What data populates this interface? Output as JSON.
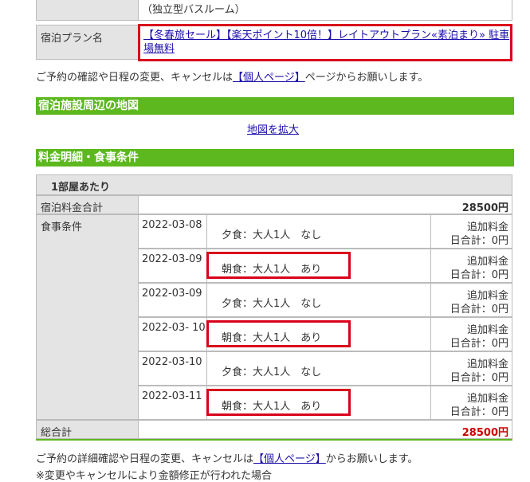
{
  "room": {
    "bath_note": "（独立型バスルーム）"
  },
  "plan": {
    "label": "宿泊プラン名",
    "name": "【冬春旅セール】【楽天ポイント10倍！】レイトアウトプラン«素泊まり» 駐車場無料"
  },
  "notice1": {
    "before": "ご予約の確認や日程の変更、キャンセルは",
    "link": "【個人ページ】",
    "after": "ページからお願いします。"
  },
  "map": {
    "title": "宿泊施設周辺の地図",
    "enlarge": "地図を拡大"
  },
  "fees": {
    "title": "料金明細・食事条件",
    "per_room": "1部屋あたり",
    "subtotal_label": "宿泊料金合計",
    "subtotal_value": "28500円",
    "meal_label": "食事条件",
    "total_label": "総合計",
    "total_value": "28500円",
    "rows": [
      {
        "date": "2022-03-08",
        "meal": "夕食：大人1人　なし",
        "extra": "追加料金",
        "day_total": "日合計：0円"
      },
      {
        "date": "2022-03-09",
        "meal": "朝食：大人1人　あり",
        "extra": "追加料金",
        "day_total": "日合計：0円"
      },
      {
        "date": "2022-03-09",
        "meal": "夕食：大人1人　なし",
        "extra": "追加料金",
        "day_total": "日合計：0円"
      },
      {
        "date": "2022-03- 10",
        "meal": "朝食：大人1人　あり",
        "extra": "追加料金",
        "day_total": "日合計：0円"
      },
      {
        "date": "2022-03-10",
        "meal": "夕食：大人1人　なし",
        "extra": "追加料金",
        "day_total": "日合計：0円"
      },
      {
        "date": "2022-03-11",
        "meal": "朝食：大人1人　あり",
        "extra": "追加料金",
        "day_total": "日合計：0円"
      }
    ]
  },
  "notice2": {
    "before": "ご予約の詳細確認や日程の変更、キャンセルは",
    "link": "【個人ページ】",
    "after": "からお願いします。"
  },
  "notice3": "※変更やキャンセルにより金額修正が行われた場合"
}
